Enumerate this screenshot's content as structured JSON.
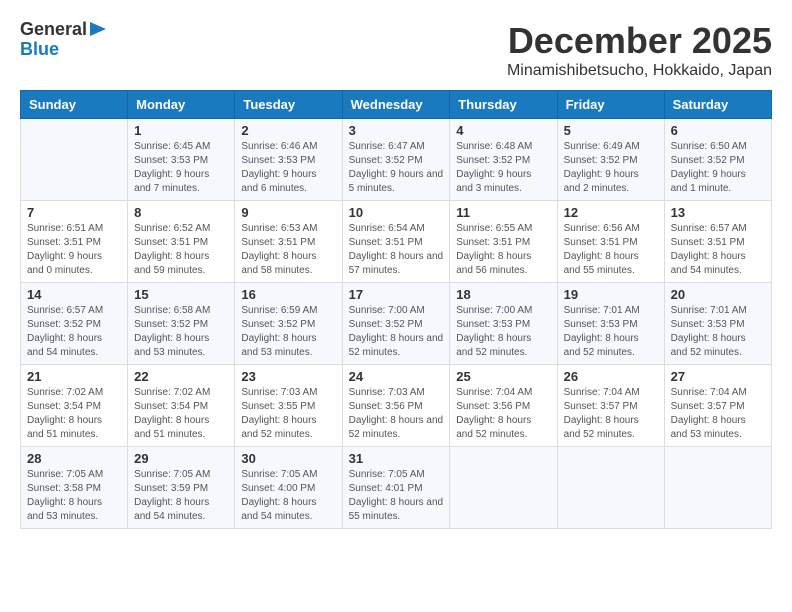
{
  "logo": {
    "general": "General",
    "blue": "Blue"
  },
  "title": "December 2025",
  "subtitle": "Minamishibetsucho, Hokkaido, Japan",
  "header_days": [
    "Sunday",
    "Monday",
    "Tuesday",
    "Wednesday",
    "Thursday",
    "Friday",
    "Saturday"
  ],
  "weeks": [
    [
      {
        "day": "",
        "sunrise": "",
        "sunset": "",
        "daylight": ""
      },
      {
        "day": "1",
        "sunrise": "6:45 AM",
        "sunset": "3:53 PM",
        "daylight": "9 hours and 7 minutes."
      },
      {
        "day": "2",
        "sunrise": "6:46 AM",
        "sunset": "3:53 PM",
        "daylight": "9 hours and 6 minutes."
      },
      {
        "day": "3",
        "sunrise": "6:47 AM",
        "sunset": "3:52 PM",
        "daylight": "9 hours and 5 minutes."
      },
      {
        "day": "4",
        "sunrise": "6:48 AM",
        "sunset": "3:52 PM",
        "daylight": "9 hours and 3 minutes."
      },
      {
        "day": "5",
        "sunrise": "6:49 AM",
        "sunset": "3:52 PM",
        "daylight": "9 hours and 2 minutes."
      },
      {
        "day": "6",
        "sunrise": "6:50 AM",
        "sunset": "3:52 PM",
        "daylight": "9 hours and 1 minute."
      }
    ],
    [
      {
        "day": "7",
        "sunrise": "6:51 AM",
        "sunset": "3:51 PM",
        "daylight": "9 hours and 0 minutes."
      },
      {
        "day": "8",
        "sunrise": "6:52 AM",
        "sunset": "3:51 PM",
        "daylight": "8 hours and 59 minutes."
      },
      {
        "day": "9",
        "sunrise": "6:53 AM",
        "sunset": "3:51 PM",
        "daylight": "8 hours and 58 minutes."
      },
      {
        "day": "10",
        "sunrise": "6:54 AM",
        "sunset": "3:51 PM",
        "daylight": "8 hours and 57 minutes."
      },
      {
        "day": "11",
        "sunrise": "6:55 AM",
        "sunset": "3:51 PM",
        "daylight": "8 hours and 56 minutes."
      },
      {
        "day": "12",
        "sunrise": "6:56 AM",
        "sunset": "3:51 PM",
        "daylight": "8 hours and 55 minutes."
      },
      {
        "day": "13",
        "sunrise": "6:57 AM",
        "sunset": "3:51 PM",
        "daylight": "8 hours and 54 minutes."
      }
    ],
    [
      {
        "day": "14",
        "sunrise": "6:57 AM",
        "sunset": "3:52 PM",
        "daylight": "8 hours and 54 minutes."
      },
      {
        "day": "15",
        "sunrise": "6:58 AM",
        "sunset": "3:52 PM",
        "daylight": "8 hours and 53 minutes."
      },
      {
        "day": "16",
        "sunrise": "6:59 AM",
        "sunset": "3:52 PM",
        "daylight": "8 hours and 53 minutes."
      },
      {
        "day": "17",
        "sunrise": "7:00 AM",
        "sunset": "3:52 PM",
        "daylight": "8 hours and 52 minutes."
      },
      {
        "day": "18",
        "sunrise": "7:00 AM",
        "sunset": "3:53 PM",
        "daylight": "8 hours and 52 minutes."
      },
      {
        "day": "19",
        "sunrise": "7:01 AM",
        "sunset": "3:53 PM",
        "daylight": "8 hours and 52 minutes."
      },
      {
        "day": "20",
        "sunrise": "7:01 AM",
        "sunset": "3:53 PM",
        "daylight": "8 hours and 52 minutes."
      }
    ],
    [
      {
        "day": "21",
        "sunrise": "7:02 AM",
        "sunset": "3:54 PM",
        "daylight": "8 hours and 51 minutes."
      },
      {
        "day": "22",
        "sunrise": "7:02 AM",
        "sunset": "3:54 PM",
        "daylight": "8 hours and 51 minutes."
      },
      {
        "day": "23",
        "sunrise": "7:03 AM",
        "sunset": "3:55 PM",
        "daylight": "8 hours and 52 minutes."
      },
      {
        "day": "24",
        "sunrise": "7:03 AM",
        "sunset": "3:56 PM",
        "daylight": "8 hours and 52 minutes."
      },
      {
        "day": "25",
        "sunrise": "7:04 AM",
        "sunset": "3:56 PM",
        "daylight": "8 hours and 52 minutes."
      },
      {
        "day": "26",
        "sunrise": "7:04 AM",
        "sunset": "3:57 PM",
        "daylight": "8 hours and 52 minutes."
      },
      {
        "day": "27",
        "sunrise": "7:04 AM",
        "sunset": "3:57 PM",
        "daylight": "8 hours and 53 minutes."
      }
    ],
    [
      {
        "day": "28",
        "sunrise": "7:05 AM",
        "sunset": "3:58 PM",
        "daylight": "8 hours and 53 minutes."
      },
      {
        "day": "29",
        "sunrise": "7:05 AM",
        "sunset": "3:59 PM",
        "daylight": "8 hours and 54 minutes."
      },
      {
        "day": "30",
        "sunrise": "7:05 AM",
        "sunset": "4:00 PM",
        "daylight": "8 hours and 54 minutes."
      },
      {
        "day": "31",
        "sunrise": "7:05 AM",
        "sunset": "4:01 PM",
        "daylight": "8 hours and 55 minutes."
      },
      {
        "day": "",
        "sunrise": "",
        "sunset": "",
        "daylight": ""
      },
      {
        "day": "",
        "sunrise": "",
        "sunset": "",
        "daylight": ""
      },
      {
        "day": "",
        "sunrise": "",
        "sunset": "",
        "daylight": ""
      }
    ]
  ]
}
